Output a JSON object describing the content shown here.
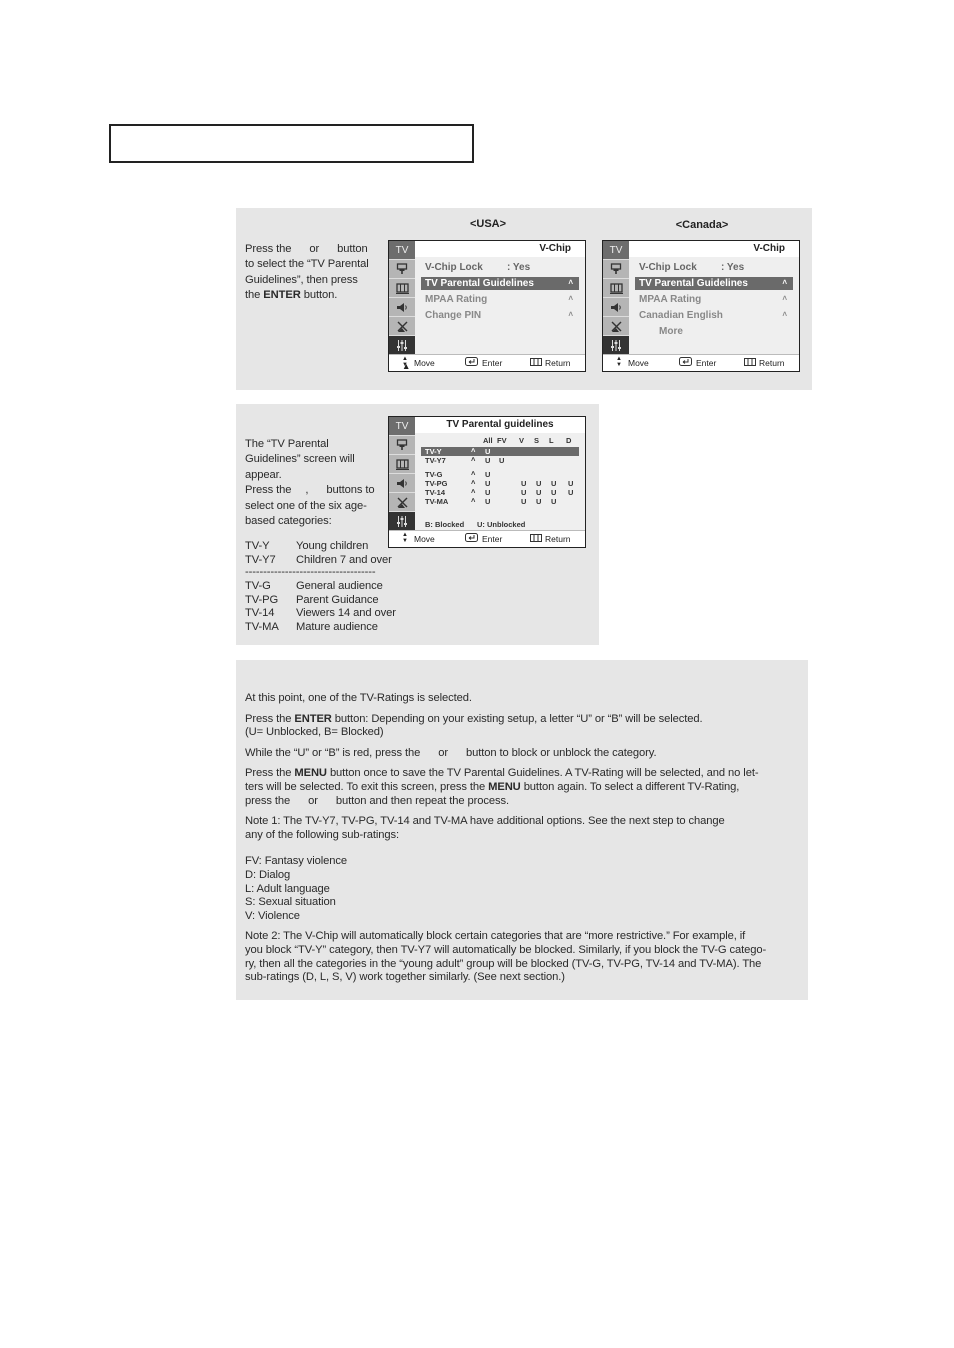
{
  "panel1": {
    "instruction": {
      "line1_a": "Press the",
      "line1_b": "or",
      "line1_c": "button",
      "line2": "to select the “TV Parental",
      "line3": "Guidelines”, then press",
      "line4_a": "the",
      "line4_bold": "ENTER",
      "line4_b": "button."
    },
    "usa": {
      "label": "<USA>",
      "header": "V-Chip",
      "sidebar_tv": "TV",
      "items": [
        {
          "label": "V-Chip Lock",
          "value": ":  Yes",
          "arrow": ""
        },
        {
          "label": "TV Parental Guidelines",
          "value": "",
          "arrow": "˄"
        },
        {
          "label": "MPAA Rating",
          "value": "",
          "arrow": "˄"
        },
        {
          "label": "Change PIN",
          "value": "",
          "arrow": "˄"
        }
      ],
      "footer": {
        "move": "Move",
        "enter": "Enter",
        "return": "Return"
      }
    },
    "canada": {
      "label": "<Canada>",
      "header": "V-Chip",
      "sidebar_tv": "TV",
      "items": [
        {
          "label": "V-Chip Lock",
          "value": ":  Yes",
          "arrow": ""
        },
        {
          "label": "TV Parental Guidelines",
          "value": "",
          "arrow": "˄"
        },
        {
          "label": "MPAA Rating",
          "value": "",
          "arrow": "˄"
        },
        {
          "label": "Canadian English",
          "value": "",
          "arrow": "˄"
        },
        {
          "label": "More",
          "value": "",
          "arrow": ""
        }
      ],
      "footer": {
        "move": "Move",
        "enter": "Enter",
        "return": "Return"
      }
    }
  },
  "panel2": {
    "instruction": {
      "line1": "The “TV Parental",
      "line2": "Guidelines” screen will",
      "line3": "appear.",
      "line4_a": "Press the",
      "line4_b": ",",
      "line4_c": "buttons to",
      "line5": "select one of the six age-",
      "line6": "based categories:"
    },
    "categories_young": [
      {
        "code": "TV-Y",
        "desc": "Young children"
      },
      {
        "code": "TV-Y7",
        "desc": "Children 7 and over"
      }
    ],
    "divider": "------------------------------------",
    "categories_adult": [
      {
        "code": "TV-G",
        "desc": "General audience"
      },
      {
        "code": "TV-PG",
        "desc": "Parent Guidance"
      },
      {
        "code": "TV-14",
        "desc": "Viewers 14 and over"
      },
      {
        "code": "TV-MA",
        "desc": "Mature audience"
      }
    ],
    "osd": {
      "header": "TV Parental guidelines",
      "sidebar_tv": "TV",
      "columns": [
        "All",
        "FV",
        "V",
        "S",
        "L",
        "D"
      ],
      "rows": [
        {
          "rating": "TV-Y",
          "cells": [
            "U",
            "",
            "",
            "",
            "",
            ""
          ],
          "selected": true
        },
        {
          "rating": "TV-Y7",
          "cells": [
            "U",
            "U",
            "",
            "",
            "",
            ""
          ],
          "selected": false
        },
        {
          "rating": "TV-G",
          "cells": [
            "U",
            "",
            "",
            "",
            "",
            ""
          ],
          "selected": false
        },
        {
          "rating": "TV-PG",
          "cells": [
            "U",
            "",
            "U",
            "U",
            "U",
            "U"
          ],
          "selected": false
        },
        {
          "rating": "TV-14",
          "cells": [
            "U",
            "",
            "U",
            "U",
            "U",
            "U"
          ],
          "selected": false
        },
        {
          "rating": "TV-MA",
          "cells": [
            "U",
            "",
            "U",
            "U",
            "U",
            ""
          ],
          "selected": false
        }
      ],
      "arrow": "˄",
      "legend_blocked": "B: Blocked",
      "legend_unblocked": "U: Unblocked",
      "footer": {
        "move": "Move",
        "enter": "Enter",
        "return": "Return"
      }
    }
  },
  "panel3": {
    "p1": "At this point, one of the TV-Ratings is selected.",
    "p2_a": "Press the",
    "p2_bold": "ENTER",
    "p2_b": " button: Depending on your existing setup, a letter “U” or “B” will be selected.",
    "p2_line2": "(U= Unblocked, B= Blocked)",
    "p3_a": "While the “U” or “B” is red, press the",
    "p3_b": "or",
    "p3_c": "button to block or unblock the category.",
    "p4_a": "Press the",
    "p4_bold1": "MENU",
    "p4_b": "button once to save the TV Parental Guidelines.  A TV-Rating will be selected, and no let-",
    "p4_c": "ters will be selected. To exit this screen, press the",
    "p4_bold2": "MENU",
    "p4_d": "button again. To select a different TV-Rating,",
    "p4_e": "press the",
    "p4_f": "or",
    "p4_g": "button and then repeat the process.",
    "note1_line1": "Note 1: The TV-Y7, TV-PG, TV-14 and TV-MA have additional options.  See the next step to change",
    "note1_line2": "any of the following sub-ratings:",
    "subratings": [
      "FV: Fantasy violence",
      "D:  Dialog",
      "L:   Adult language",
      "S:  Sexual situation",
      "V:  Violence"
    ],
    "note2_lines": [
      "Note 2: The V-Chip will automatically block certain categories that are “more restrictive.” For example, if",
      "you block “TV-Y” category, then TV-Y7 will automatically be blocked. Similarly, if you block the TV-G catego-",
      "ry, then all the categories in the “young adult” group will be blocked (TV-G, TV-PG, TV-14 and TV-MA). The",
      "sub-ratings (D, L, S, V) work together similarly. (See next section.)"
    ]
  }
}
